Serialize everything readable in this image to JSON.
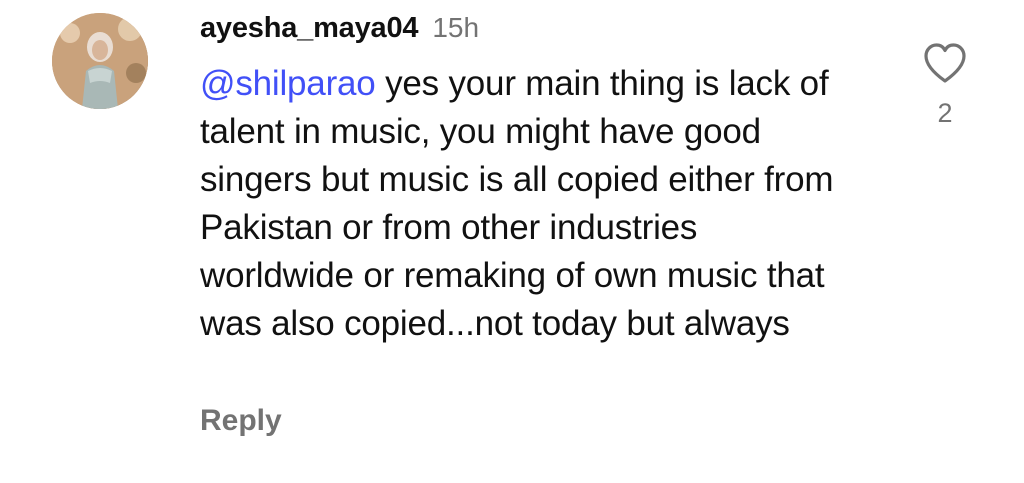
{
  "comment": {
    "username": "ayesha_maya04",
    "timestamp": "15h",
    "mention": "@shilparao",
    "text": " yes your main thing is lack of talent in music, you might have good singers but music is all copied either from Pakistan or from other industries worldwide or remaking of own music that was also copied...not today but always",
    "reply_label": "Reply",
    "like_count": "2",
    "like_icon": "heart-outline-icon",
    "avatar_icon": "profile-photo",
    "colors": {
      "mention": "#4150f7",
      "secondary_text": "#737373",
      "primary_text": "#111111"
    }
  }
}
